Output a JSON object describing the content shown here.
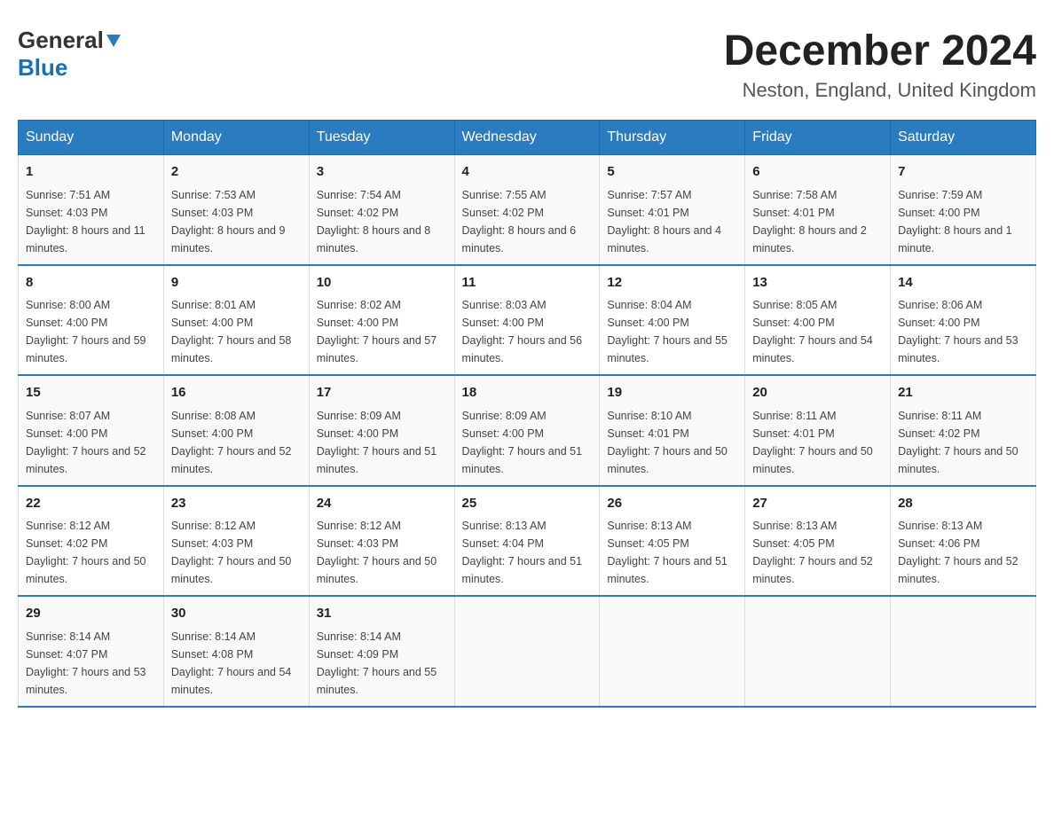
{
  "header": {
    "logo": {
      "general": "General",
      "blue": "Blue"
    },
    "title": "December 2024",
    "subtitle": "Neston, England, United Kingdom"
  },
  "calendar": {
    "weekdays": [
      "Sunday",
      "Monday",
      "Tuesday",
      "Wednesday",
      "Thursday",
      "Friday",
      "Saturday"
    ],
    "weeks": [
      [
        {
          "day": "1",
          "sunrise": "7:51 AM",
          "sunset": "4:03 PM",
          "daylight": "8 hours and 11 minutes."
        },
        {
          "day": "2",
          "sunrise": "7:53 AM",
          "sunset": "4:03 PM",
          "daylight": "8 hours and 9 minutes."
        },
        {
          "day": "3",
          "sunrise": "7:54 AM",
          "sunset": "4:02 PM",
          "daylight": "8 hours and 8 minutes."
        },
        {
          "day": "4",
          "sunrise": "7:55 AM",
          "sunset": "4:02 PM",
          "daylight": "8 hours and 6 minutes."
        },
        {
          "day": "5",
          "sunrise": "7:57 AM",
          "sunset": "4:01 PM",
          "daylight": "8 hours and 4 minutes."
        },
        {
          "day": "6",
          "sunrise": "7:58 AM",
          "sunset": "4:01 PM",
          "daylight": "8 hours and 2 minutes."
        },
        {
          "day": "7",
          "sunrise": "7:59 AM",
          "sunset": "4:00 PM",
          "daylight": "8 hours and 1 minute."
        }
      ],
      [
        {
          "day": "8",
          "sunrise": "8:00 AM",
          "sunset": "4:00 PM",
          "daylight": "7 hours and 59 minutes."
        },
        {
          "day": "9",
          "sunrise": "8:01 AM",
          "sunset": "4:00 PM",
          "daylight": "7 hours and 58 minutes."
        },
        {
          "day": "10",
          "sunrise": "8:02 AM",
          "sunset": "4:00 PM",
          "daylight": "7 hours and 57 minutes."
        },
        {
          "day": "11",
          "sunrise": "8:03 AM",
          "sunset": "4:00 PM",
          "daylight": "7 hours and 56 minutes."
        },
        {
          "day": "12",
          "sunrise": "8:04 AM",
          "sunset": "4:00 PM",
          "daylight": "7 hours and 55 minutes."
        },
        {
          "day": "13",
          "sunrise": "8:05 AM",
          "sunset": "4:00 PM",
          "daylight": "7 hours and 54 minutes."
        },
        {
          "day": "14",
          "sunrise": "8:06 AM",
          "sunset": "4:00 PM",
          "daylight": "7 hours and 53 minutes."
        }
      ],
      [
        {
          "day": "15",
          "sunrise": "8:07 AM",
          "sunset": "4:00 PM",
          "daylight": "7 hours and 52 minutes."
        },
        {
          "day": "16",
          "sunrise": "8:08 AM",
          "sunset": "4:00 PM",
          "daylight": "7 hours and 52 minutes."
        },
        {
          "day": "17",
          "sunrise": "8:09 AM",
          "sunset": "4:00 PM",
          "daylight": "7 hours and 51 minutes."
        },
        {
          "day": "18",
          "sunrise": "8:09 AM",
          "sunset": "4:00 PM",
          "daylight": "7 hours and 51 minutes."
        },
        {
          "day": "19",
          "sunrise": "8:10 AM",
          "sunset": "4:01 PM",
          "daylight": "7 hours and 50 minutes."
        },
        {
          "day": "20",
          "sunrise": "8:11 AM",
          "sunset": "4:01 PM",
          "daylight": "7 hours and 50 minutes."
        },
        {
          "day": "21",
          "sunrise": "8:11 AM",
          "sunset": "4:02 PM",
          "daylight": "7 hours and 50 minutes."
        }
      ],
      [
        {
          "day": "22",
          "sunrise": "8:12 AM",
          "sunset": "4:02 PM",
          "daylight": "7 hours and 50 minutes."
        },
        {
          "day": "23",
          "sunrise": "8:12 AM",
          "sunset": "4:03 PM",
          "daylight": "7 hours and 50 minutes."
        },
        {
          "day": "24",
          "sunrise": "8:12 AM",
          "sunset": "4:03 PM",
          "daylight": "7 hours and 50 minutes."
        },
        {
          "day": "25",
          "sunrise": "8:13 AM",
          "sunset": "4:04 PM",
          "daylight": "7 hours and 51 minutes."
        },
        {
          "day": "26",
          "sunrise": "8:13 AM",
          "sunset": "4:05 PM",
          "daylight": "7 hours and 51 minutes."
        },
        {
          "day": "27",
          "sunrise": "8:13 AM",
          "sunset": "4:05 PM",
          "daylight": "7 hours and 52 minutes."
        },
        {
          "day": "28",
          "sunrise": "8:13 AM",
          "sunset": "4:06 PM",
          "daylight": "7 hours and 52 minutes."
        }
      ],
      [
        {
          "day": "29",
          "sunrise": "8:14 AM",
          "sunset": "4:07 PM",
          "daylight": "7 hours and 53 minutes."
        },
        {
          "day": "30",
          "sunrise": "8:14 AM",
          "sunset": "4:08 PM",
          "daylight": "7 hours and 54 minutes."
        },
        {
          "day": "31",
          "sunrise": "8:14 AM",
          "sunset": "4:09 PM",
          "daylight": "7 hours and 55 minutes."
        },
        null,
        null,
        null,
        null
      ]
    ]
  }
}
